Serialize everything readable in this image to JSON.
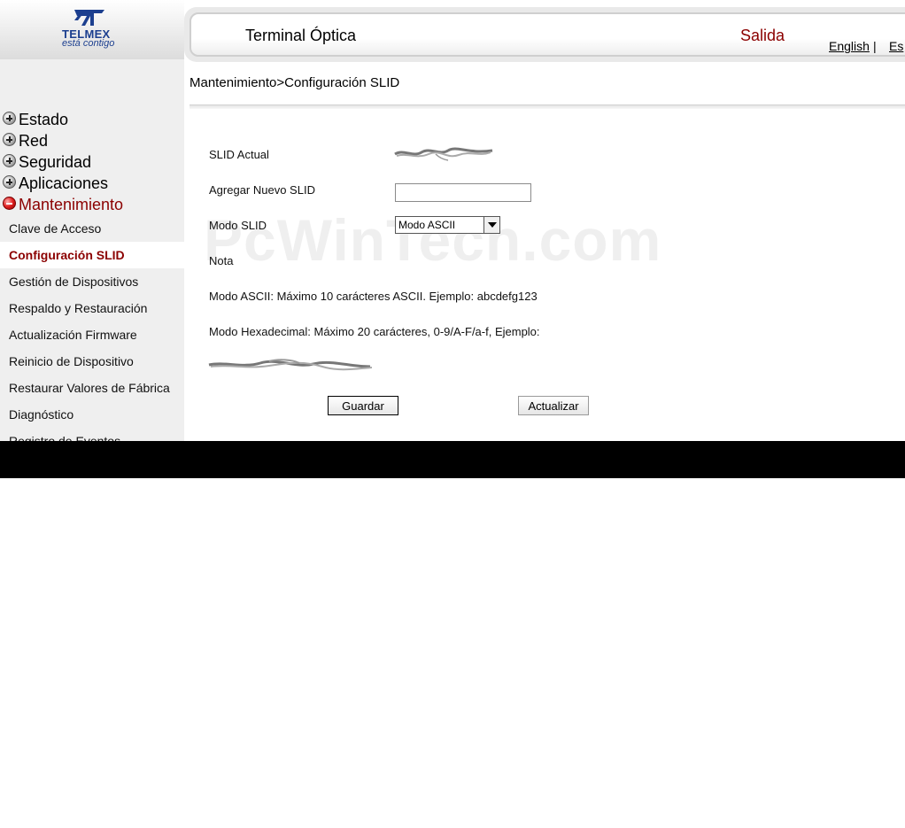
{
  "brand": {
    "name": "TELMEX",
    "tagline": "está contigo"
  },
  "header": {
    "title": "Terminal Óptica",
    "exit_label": "Salida",
    "lang_english": "English",
    "lang_separator": "|",
    "lang_spanish": "Es"
  },
  "sidebar": {
    "top_items": [
      {
        "label": "Estado",
        "icon": "plus-icon"
      },
      {
        "label": "Red",
        "icon": "plus-icon"
      },
      {
        "label": "Seguridad",
        "icon": "plus-icon"
      },
      {
        "label": "Aplicaciones",
        "icon": "plus-icon"
      },
      {
        "label": "Mantenimiento",
        "icon": "minus-icon"
      }
    ],
    "sub_items": [
      {
        "label": "Clave de Acceso"
      },
      {
        "label": "Configuración SLID"
      },
      {
        "label": "Gestión de Dispositivos"
      },
      {
        "label": "Respaldo y Restauración"
      },
      {
        "label": "Actualización Firmware"
      },
      {
        "label": "Reinicio de Dispositivo"
      },
      {
        "label": "Restaurar Valores de Fábrica"
      },
      {
        "label": "Diagnóstico"
      },
      {
        "label": "Registro de Eventos"
      }
    ]
  },
  "breadcrumb": "Mantenimiento>Configuración SLID",
  "form": {
    "current_slid_label": "SLID Actual",
    "new_slid_label": "Agregar Nuevo SLID",
    "new_slid_value": "",
    "mode_label": "Modo SLID",
    "mode_selected": "Modo ASCII",
    "note_label": "Nota",
    "note_ascii": "Modo ASCII: Máximo 10 carácteres ASCII. Ejemplo: abcdefg123",
    "note_hex": "Modo Hexadecimal: Máximo 20 carácteres, 0-9/A-F/a-f, Ejemplo:",
    "save_label": "Guardar",
    "refresh_label": "Actualizar"
  },
  "watermark": "PcWinTech.com",
  "colors": {
    "accent_red": "#8b0000",
    "brand_blue": "#1c3f8f",
    "sidebar_bg": "#efefef"
  }
}
